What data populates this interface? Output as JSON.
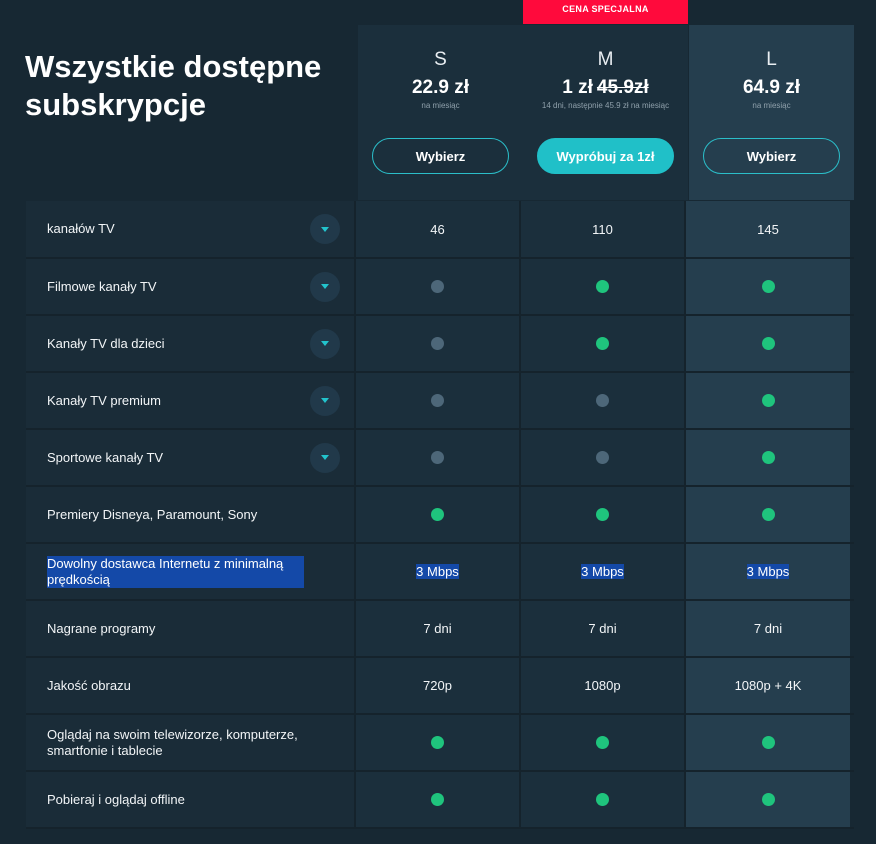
{
  "badge": "CENA SPECJALNA",
  "title": "Wszystkie dostępne subskrypcje",
  "colors": {
    "accent": "#20c0c8",
    "badge": "#ff0a3c",
    "check_on": "#1fc47d",
    "check_off": "#4d6779"
  },
  "plans": [
    {
      "name": "S",
      "price": "22.9 zł",
      "old_price": "",
      "note": "na miesiąc",
      "button": "Wybierz"
    },
    {
      "name": "M",
      "price": "1 zł",
      "old_price": "45.9zł",
      "note": "14 dni, następnie 45.9 zł na miesiąc",
      "button": "Wypróbuj za 1zł"
    },
    {
      "name": "L",
      "price": "64.9 zł",
      "old_price": "",
      "note": "na miesiąc",
      "button": "Wybierz"
    }
  ],
  "rows": [
    {
      "label": "kanałów TV",
      "expandable": true,
      "values": [
        "46",
        "110",
        "145"
      ],
      "height": 58
    },
    {
      "label": "Filmowe kanały TV",
      "expandable": true,
      "values": [
        "off",
        "on",
        "on"
      ],
      "height": 58
    },
    {
      "label": "Kanały TV dla dzieci",
      "expandable": true,
      "values": [
        "off",
        "on",
        "on"
      ],
      "height": 58
    },
    {
      "label": "Kanały TV premium",
      "expandable": true,
      "values": [
        "off",
        "off",
        "on"
      ],
      "height": 58
    },
    {
      "label": "Sportowe kanały TV",
      "expandable": true,
      "values": [
        "off",
        "off",
        "on"
      ],
      "height": 58
    },
    {
      "label": "Premiery Disneya, Paramount, Sony",
      "expandable": false,
      "values": [
        "on",
        "on",
        "on"
      ],
      "height": 58
    },
    {
      "label": "Dowolny dostawca Internetu z minimalną prędkością",
      "expandable": false,
      "values": [
        "3 Mbps",
        "3 Mbps",
        "3 Mbps"
      ],
      "highlight": true,
      "height": 58
    },
    {
      "label": "Nagrane programy",
      "expandable": false,
      "values": [
        "7 dni",
        "7 dni",
        "7 dni"
      ],
      "height": 58
    },
    {
      "label": "Jakość obrazu",
      "expandable": false,
      "values": [
        "720p",
        "1080p",
        "1080p + 4K"
      ],
      "height": 58
    },
    {
      "label": "Oglądaj na swoim telewizorze, komputerze, smartfonie i tablecie",
      "expandable": false,
      "values": [
        "on",
        "on",
        "on"
      ],
      "height": 58
    },
    {
      "label": "Pobieraj i oglądaj offline",
      "expandable": false,
      "values": [
        "on",
        "on",
        "on"
      ],
      "height": 58
    }
  ]
}
